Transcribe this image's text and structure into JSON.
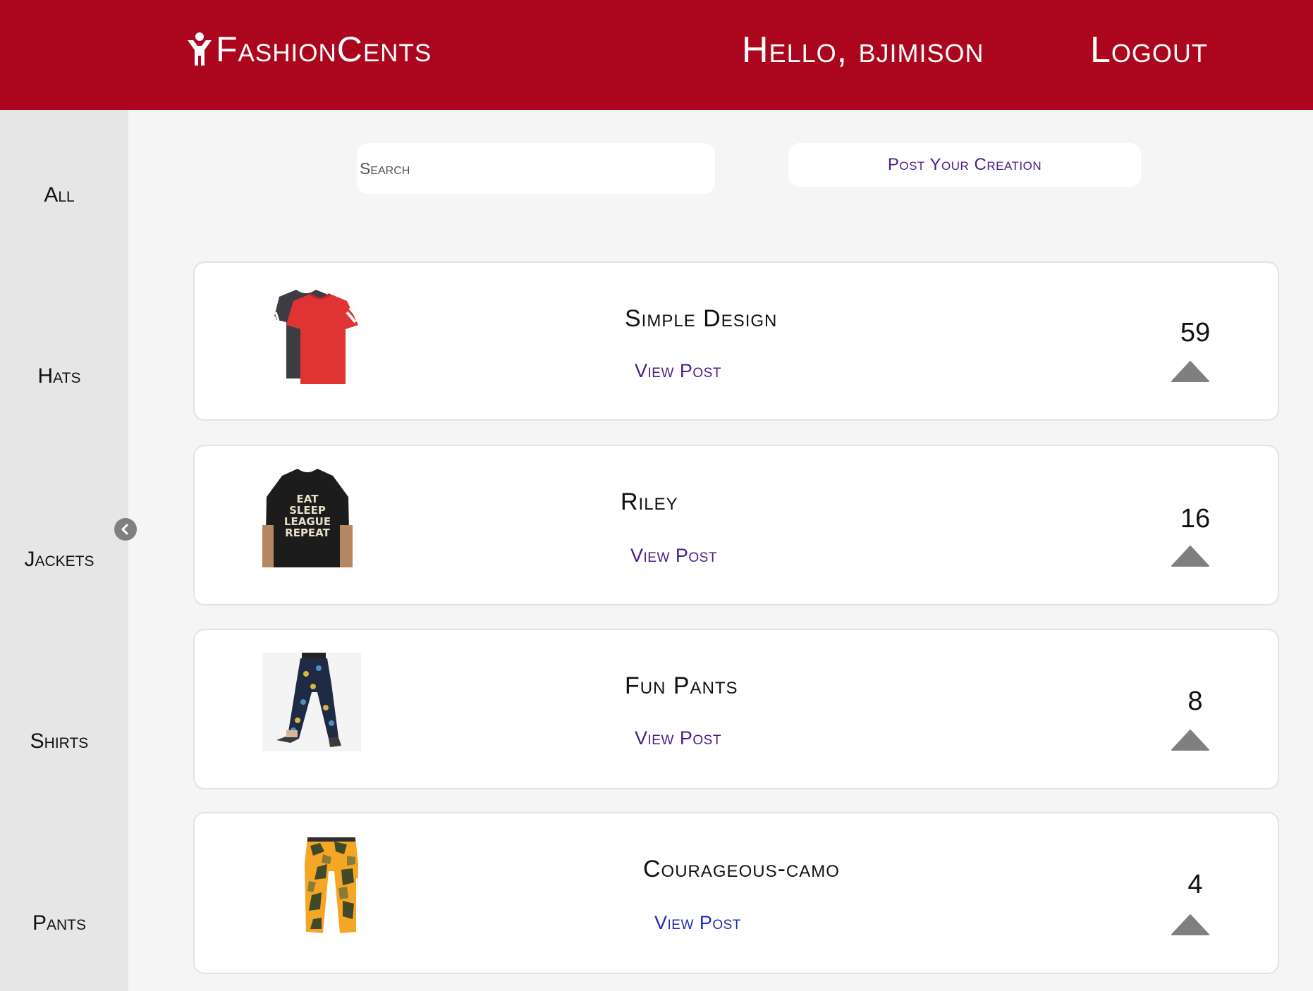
{
  "header": {
    "brand": "FashionCents",
    "greeting": "Hello, bjimison",
    "logout": "Logout",
    "color": "#ac061e"
  },
  "sidebar": {
    "categories": [
      {
        "label": "All"
      },
      {
        "label": "Hats"
      },
      {
        "label": "Jackets"
      },
      {
        "label": "Shirts"
      },
      {
        "label": "Pants"
      }
    ],
    "collapse_icon": "chevron-left-icon"
  },
  "toolbar": {
    "search_placeholder": "Search",
    "post_button": "Post Your Creation"
  },
  "posts": [
    {
      "title": "Simple Design",
      "link": "View Post",
      "votes": "59",
      "image": "tshirt-red-grey"
    },
    {
      "title": "Riley",
      "link": "View Post",
      "votes": "16",
      "image": "tshirt-black-print"
    },
    {
      "title": "Fun Pants",
      "link": "View Post",
      "votes": "8",
      "image": "floral-pants"
    },
    {
      "title": "Courageous-camo",
      "link": "View Post",
      "votes": "4",
      "image": "camo-pants"
    }
  ],
  "icons": {
    "upvote": "triangle-up-icon"
  }
}
